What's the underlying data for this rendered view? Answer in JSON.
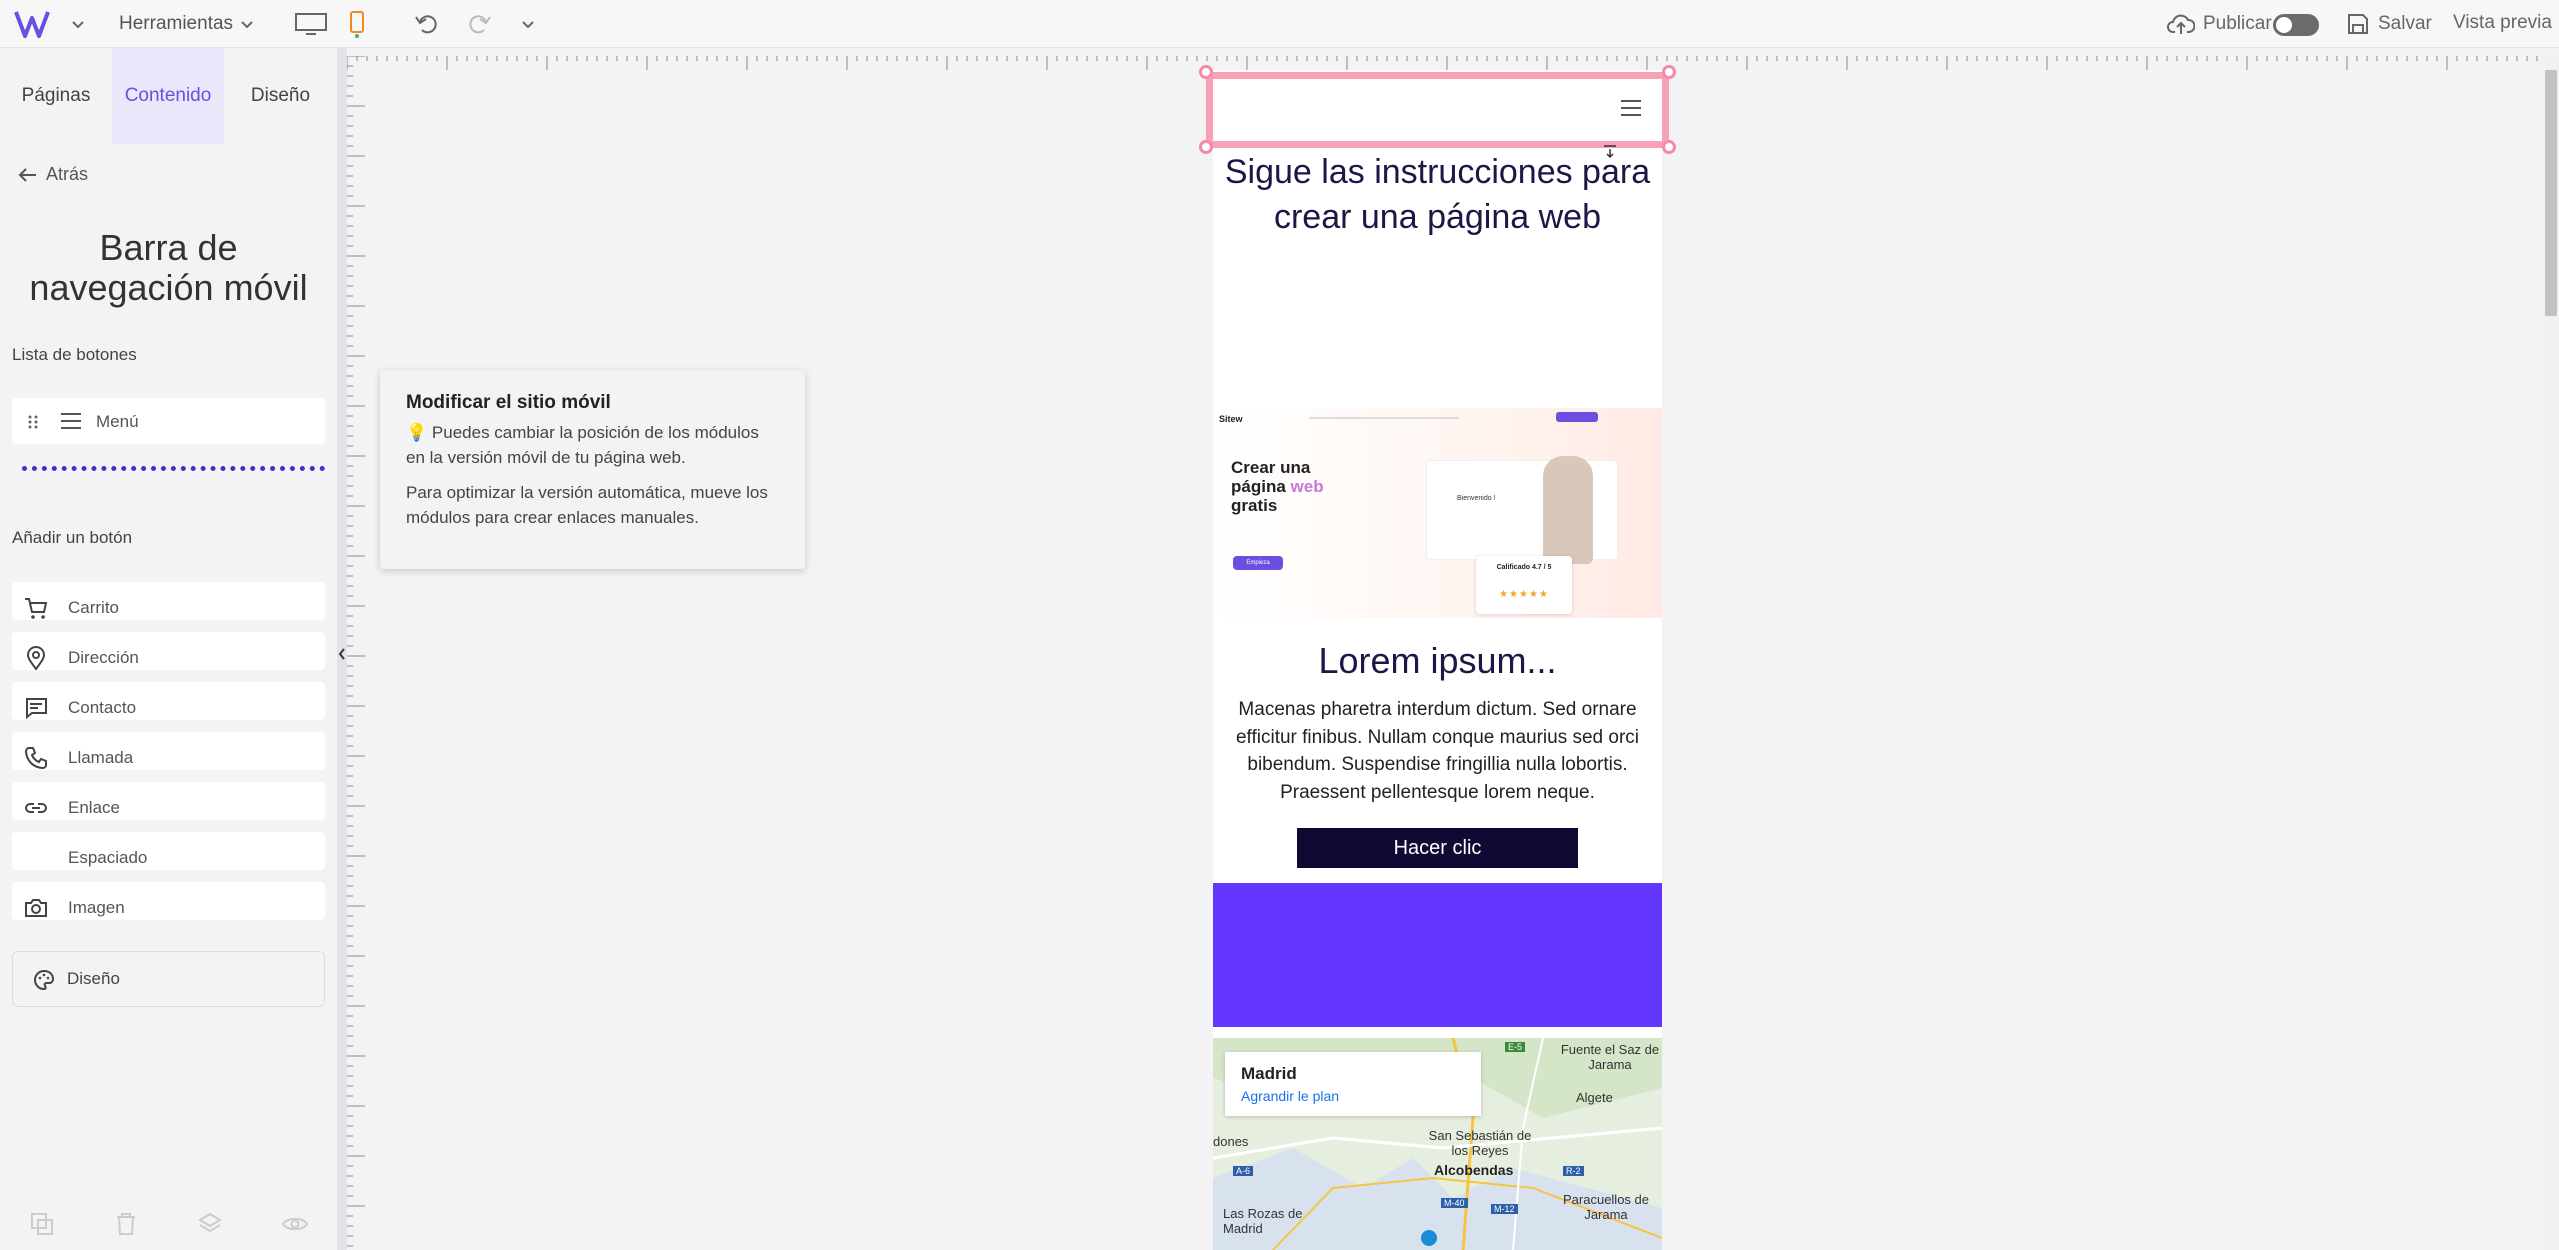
{
  "toolbar": {
    "tools_label": "Herramientas",
    "publish_label": "Publicar",
    "save_label": "Salvar",
    "preview_label": "Vista previa",
    "colors": {
      "accent": "#6a4fe0",
      "mobile_active": "#f08a24"
    }
  },
  "leftpanel": {
    "tabs": [
      {
        "label": "Páginas"
      },
      {
        "label": "Contenido"
      },
      {
        "label": "Diseño"
      }
    ],
    "back_label": "Atrás",
    "title_line1": "Barra de",
    "title_line2": "navegación móvil",
    "buttons_list_label": "Lista de botones",
    "menu_button_label": "Menú",
    "add_button_label": "Añadir un botón",
    "add_items": [
      {
        "label": "Carrito",
        "icon": "cart-icon"
      },
      {
        "label": "Dirección",
        "icon": "location-icon"
      },
      {
        "label": "Contacto",
        "icon": "chat-icon"
      },
      {
        "label": "Llamada",
        "icon": "phone-icon"
      },
      {
        "label": "Enlace",
        "icon": "link-icon"
      },
      {
        "label": "Espaciado",
        "icon": ""
      },
      {
        "label": "Imagen",
        "icon": "camera-icon"
      }
    ],
    "design_label": "Diseño"
  },
  "tooltip": {
    "title": "Modificar el sitio móvil",
    "text1": "Puedes cambiar la posición de los módulos en la versión móvil de tu página web.",
    "text2": "Para optimizar la versión automática, mueve los módulos para crear enlaces manuales."
  },
  "phone": {
    "title": "Sigue las instrucciones para crear una página web",
    "screenshot": {
      "logo": "Sitew",
      "headline_1": "Crear una",
      "headline_2": "página",
      "headline_accent": "web",
      "headline_3": "gratis",
      "card_welcome": "Bienvenido !",
      "rating": "Calificado 4.7 / 5",
      "cta": "Empieza"
    },
    "heading": "Lorem ipsum...",
    "body": "Macenas pharetra interdum dictum. Sed ornare efficitur finibus. Nullam conque maurius sed orci bibendum. Suspendise fringillia nulla lobortis. Praessent pellentesque lorem neque.",
    "button_label": "Hacer clic",
    "purple_color": "#6236ff",
    "map": {
      "city": "Madrid",
      "link": "Agrandir le plan",
      "places": [
        "Fuente el Saz de Jarama",
        "Algete",
        "San Sebastián de los Reyes",
        "Alcobendas",
        "Las Rozas de Madrid",
        "Paracuellos de Jarama",
        "dones"
      ],
      "roads": [
        "E-5",
        "A-6",
        "R-2",
        "M-40",
        "M-12"
      ]
    }
  }
}
